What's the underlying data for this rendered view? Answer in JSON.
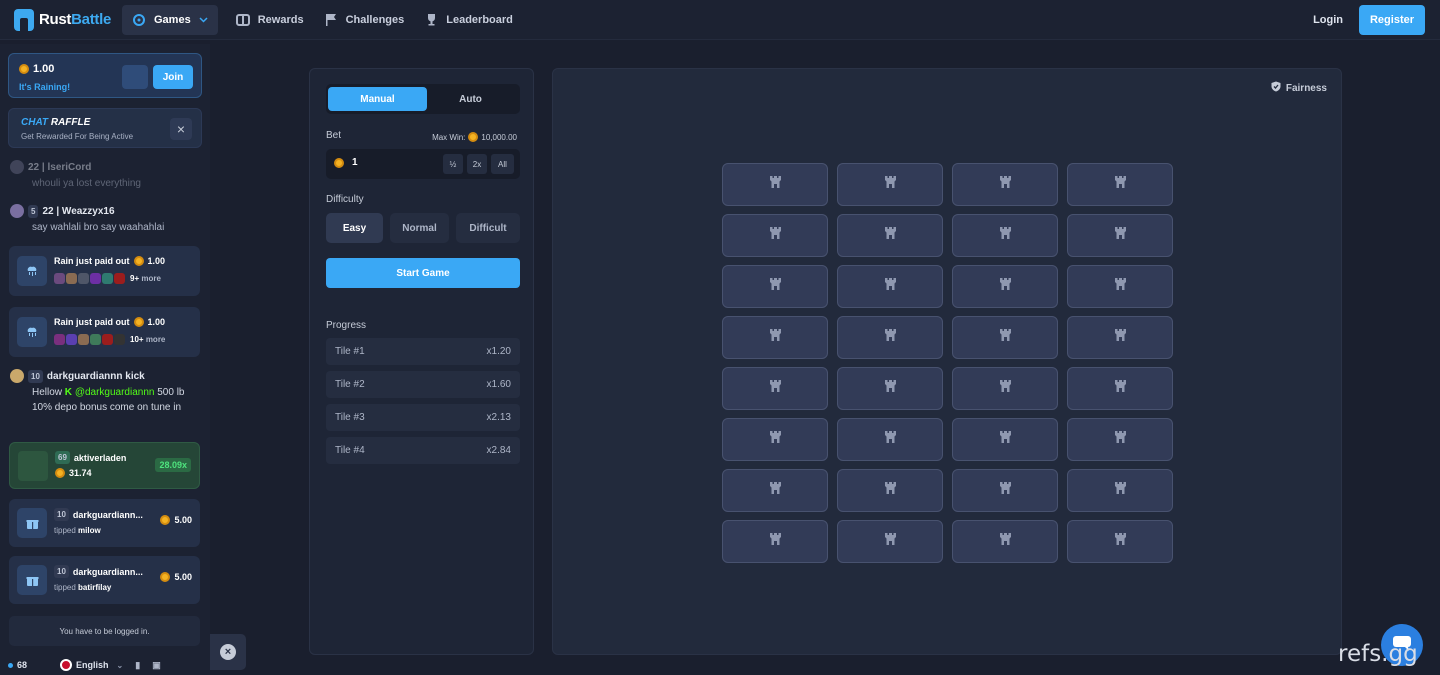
{
  "nav": {
    "logo_a": "Rust",
    "logo_b": "Battle",
    "games": "Games",
    "rewards": "Rewards",
    "challenges": "Challenges",
    "leaderboard": "Leaderboard",
    "login": "Login",
    "register": "Register"
  },
  "sidebar": {
    "rain": {
      "amount": "1.00",
      "status": "It's Raining!",
      "join": "Join"
    },
    "raffle": {
      "title_a": "CHAT",
      "title_b": "RAFFLE",
      "subtitle": "Get Rewarded For Being Active"
    },
    "messages": [
      {
        "level": "",
        "user": "22 | lseriCord",
        "text": "whouli ya lost everything"
      },
      {
        "level": "5",
        "user": "22 | Weazzyx16",
        "text": "say wahlali bro say waahahlai"
      },
      {
        "level": "10",
        "user": "darkguardiannn kick",
        "text_a": "Hellow",
        "mention": "@darkguardiannn",
        "text_b": "500 lb 10% depo bonus come on tune in"
      }
    ],
    "rain_feed": [
      {
        "label": "Rain just paid out",
        "amount": "1.00",
        "more_count": "9+",
        "more_label": "more"
      },
      {
        "label": "Rain just paid out",
        "amount": "1.00",
        "more_count": "10+",
        "more_label": "more"
      }
    ],
    "win": {
      "level": "69",
      "user": "aktiverladen",
      "amount": "31.74",
      "multiplier": "28.09x"
    },
    "tips": [
      {
        "level": "10",
        "user": "darkguardiann...",
        "tipped": "tipped",
        "to": "milow",
        "amount": "5.00"
      },
      {
        "level": "10",
        "user": "darkguardiann...",
        "tipped": "tipped",
        "to": "batirfilay",
        "amount": "5.00"
      }
    ],
    "logged_in_notice": "You have to be logged in.",
    "online_count": "68",
    "language": "English"
  },
  "controls": {
    "tab_manual": "Manual",
    "tab_auto": "Auto",
    "bet_label": "Bet",
    "max_win_label": "Max Win:",
    "max_win_value": "10,000.00",
    "bet_value": "1",
    "half": "½",
    "double": "2x",
    "all": "All",
    "difficulty_label": "Difficulty",
    "difficulty": {
      "easy": "Easy",
      "normal": "Normal",
      "difficult": "Difficult",
      "selected": "Easy"
    },
    "start": "Start Game",
    "progress_label": "Progress",
    "progress": [
      {
        "tile": "Tile #1",
        "mult": "x1.20"
      },
      {
        "tile": "Tile #2",
        "mult": "x1.60"
      },
      {
        "tile": "Tile #3",
        "mult": "x2.13"
      },
      {
        "tile": "Tile #4",
        "mult": "x2.84"
      }
    ]
  },
  "board": {
    "fairness": "Fairness",
    "rows": 8,
    "cols": 4,
    "tile_icon": "tower-icon"
  },
  "watermark": "refs.gg",
  "colors": {
    "accent": "#3aa8f5",
    "background": "#1a1f2e",
    "panel": "#1e2536",
    "tile": "#323b57",
    "win_green": "#4ee37d",
    "coin": "#f4b223"
  }
}
